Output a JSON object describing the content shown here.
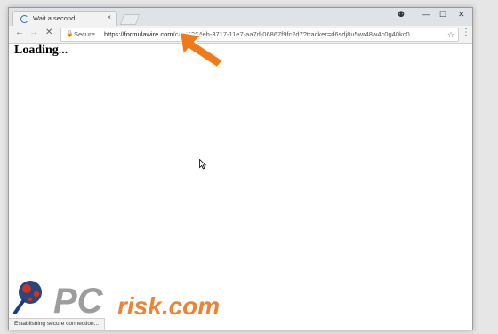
{
  "browser": {
    "tab": {
      "title": "Wait a second ...",
      "close_glyph": "×"
    },
    "window_controls": {
      "account_glyph": "⚉",
      "minimize_glyph": "—",
      "maximize_glyph": "☐",
      "close_glyph": "✕"
    },
    "nav": {
      "back_glyph": "←",
      "forward_glyph": "→",
      "stop_glyph": "✕"
    },
    "omnibox": {
      "lock_glyph": "🔒",
      "security_label": "Secure",
      "url_host": "https://formulawire.com",
      "url_path": "/c/179964eb-3717-11e7-aa7d-06867f9fc2d7?tracker=d6sdj8u5wr48w4c0g40kc0...",
      "star_glyph": "☆"
    },
    "menu_glyph": "⋮"
  },
  "page": {
    "loading_text": "Loading...",
    "status_text": "Establishing secure connection..."
  },
  "watermark": {
    "text": "PCrisk.com",
    "brand_colors": {
      "red": "#d6301f",
      "blue": "#1e3c78",
      "gray": "#8c8c8c",
      "orange": "#e87722"
    }
  },
  "annotation": {
    "arrow_color": "#f07a1a",
    "icon": "arrow-pointer-icon"
  },
  "colors": {
    "chrome_frame": "#dfe3e8",
    "toolbar": "#f2f2f2",
    "spinner": "#1a73e8"
  }
}
